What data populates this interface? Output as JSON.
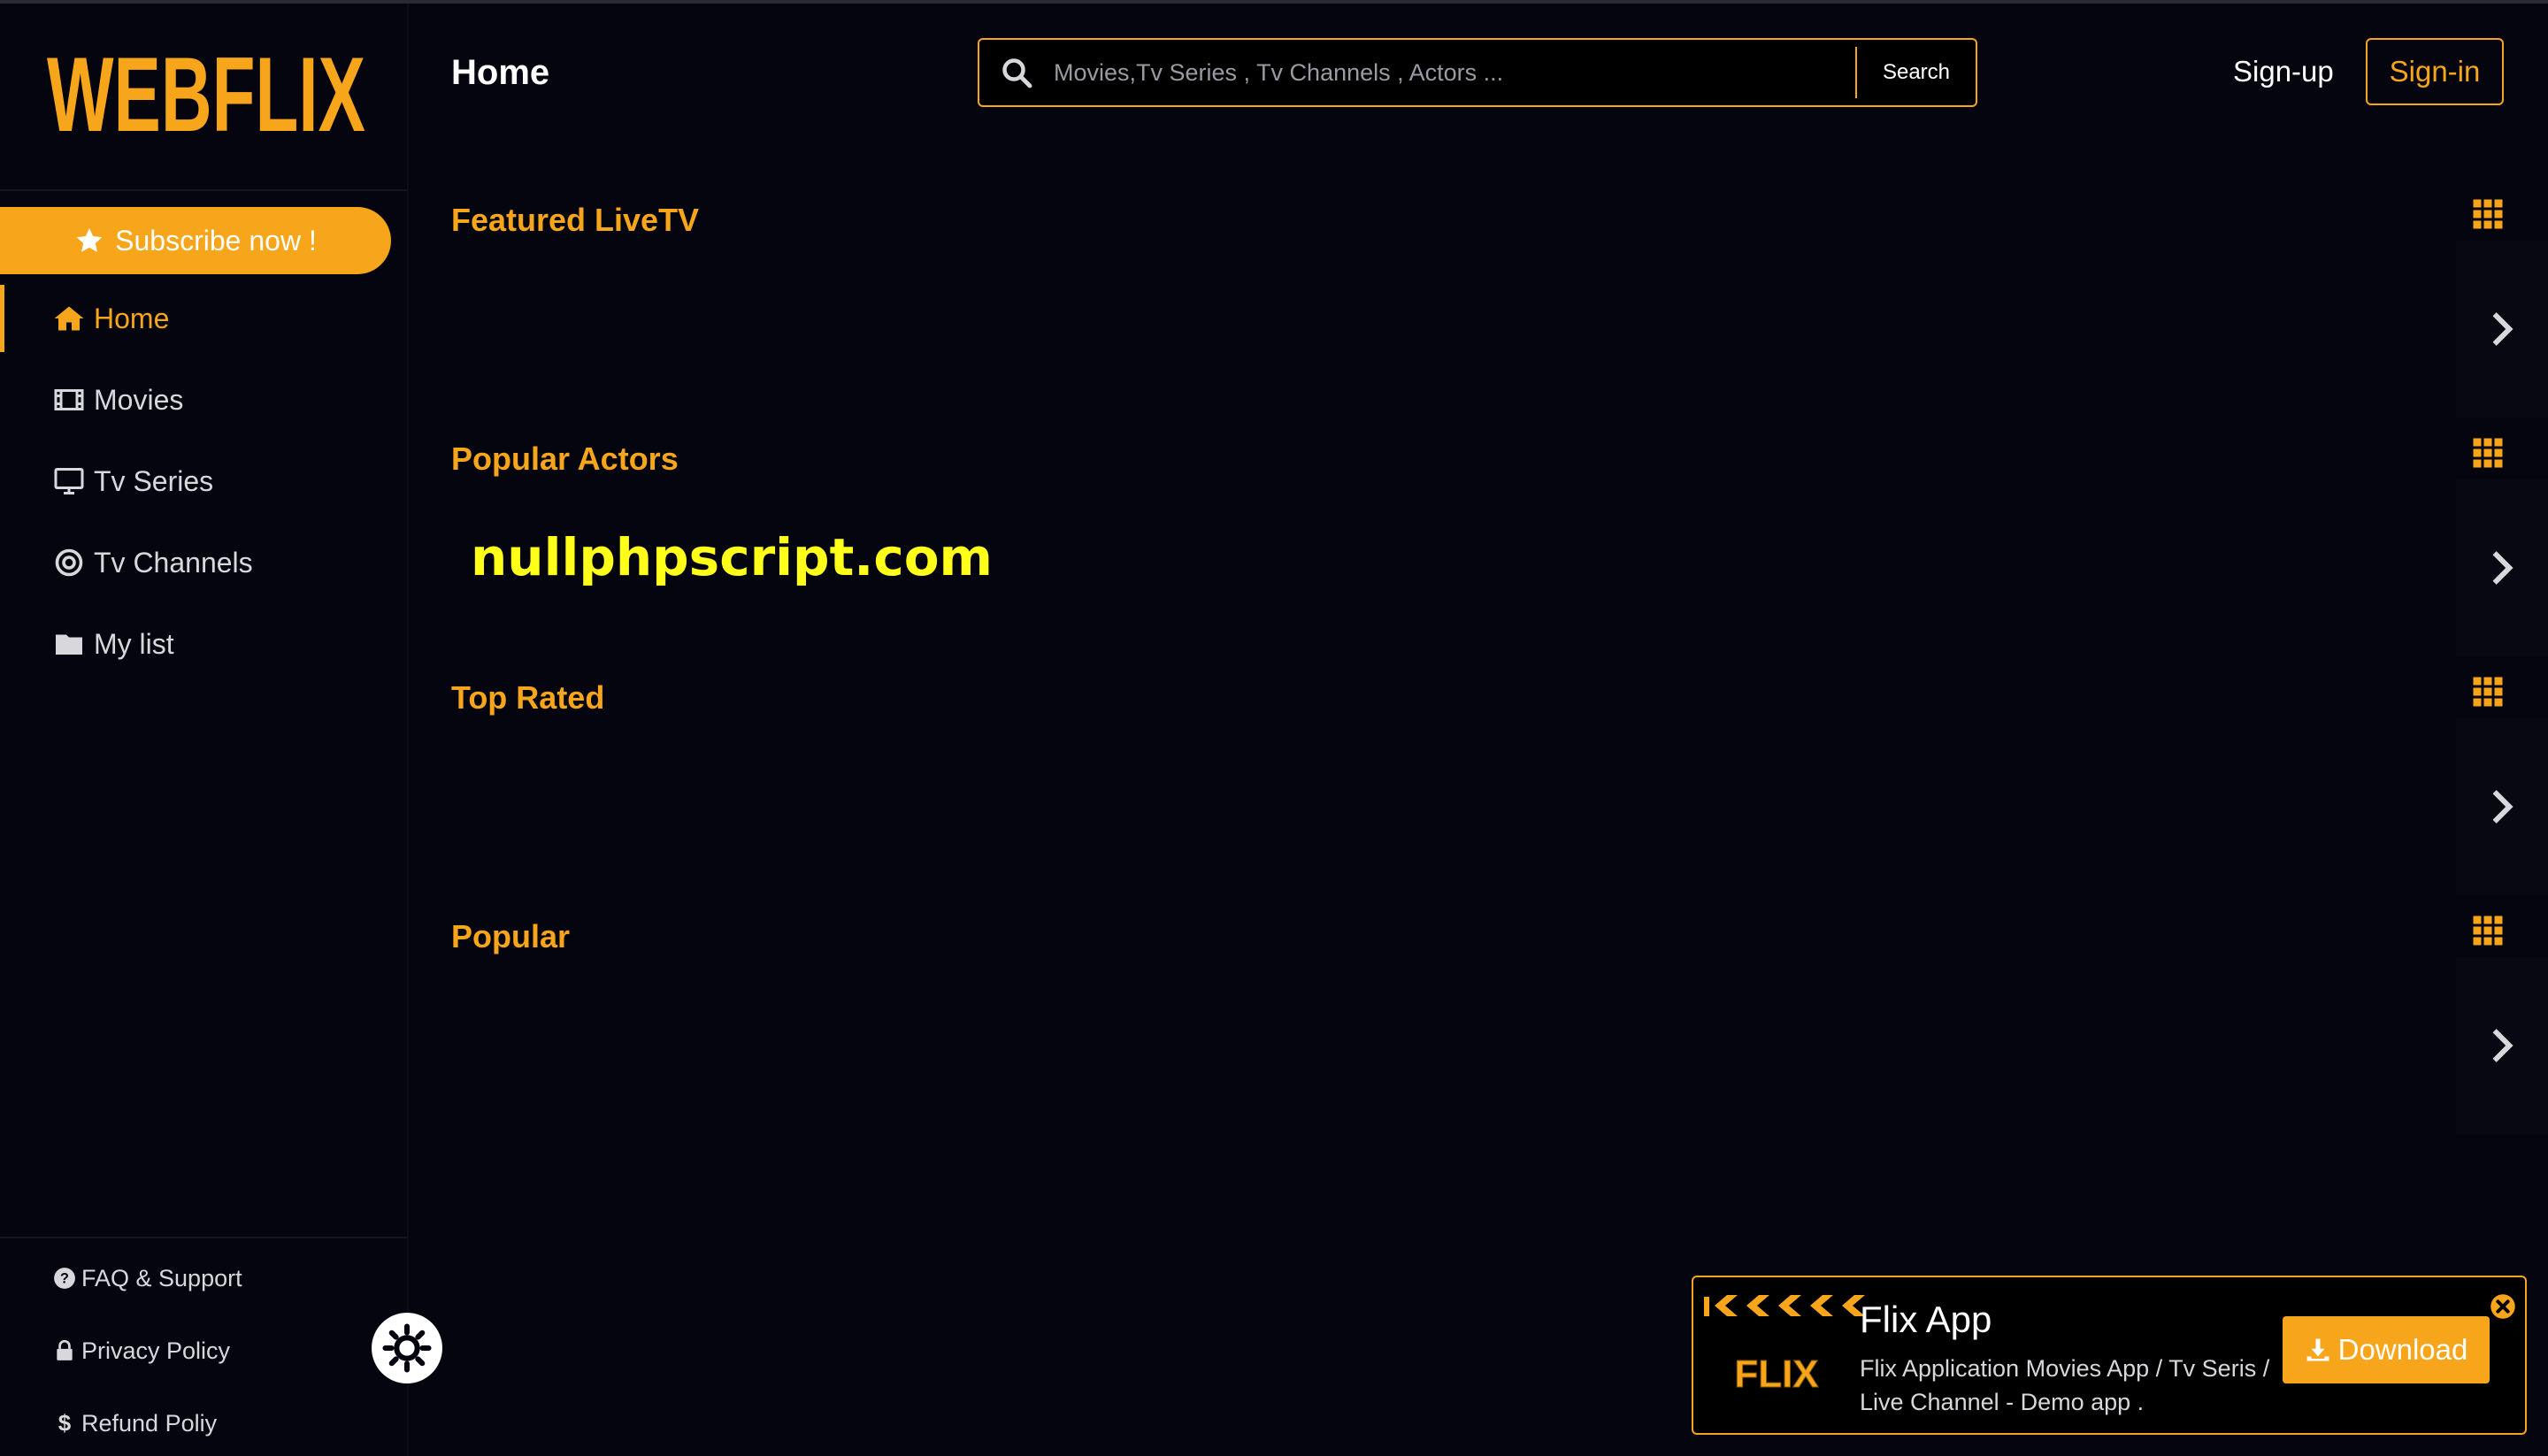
{
  "brand": {
    "name": "WEBFLIX",
    "accent": "#f7a51b",
    "background": "#05050f"
  },
  "sidebar": {
    "subscribe_label": "Subscribe now !",
    "items": [
      {
        "label": "Home",
        "icon": "home-icon",
        "active": true
      },
      {
        "label": "Movies",
        "icon": "film-icon",
        "active": false
      },
      {
        "label": "Tv Series",
        "icon": "monitor-icon",
        "active": false
      },
      {
        "label": "Tv Channels",
        "icon": "target-icon",
        "active": false
      },
      {
        "label": "My list",
        "icon": "folder-icon",
        "active": false
      }
    ],
    "footer": [
      {
        "label": "FAQ & Support",
        "icon": "question-icon"
      },
      {
        "label": "Privacy Policy",
        "icon": "lock-icon"
      },
      {
        "label": "Refund Poliy",
        "icon": "dollar-icon"
      }
    ]
  },
  "header": {
    "title": "Home",
    "search_placeholder": "Movies,Tv Series , Tv Channels , Actors ...",
    "search_button": "Search",
    "signup": "Sign-up",
    "signin": "Sign-in"
  },
  "sections": [
    {
      "title": "Featured LiveTV"
    },
    {
      "title": "Popular Actors"
    },
    {
      "title": "Top Rated"
    },
    {
      "title": "Popular"
    }
  ],
  "watermark": "nullphpscript.com",
  "app_banner": {
    "title": "Flix App",
    "description": "Flix Application Movies App / Tv Seris / Live Channel - Demo app .",
    "download_label": "Download",
    "logo_text": "FLIX"
  }
}
